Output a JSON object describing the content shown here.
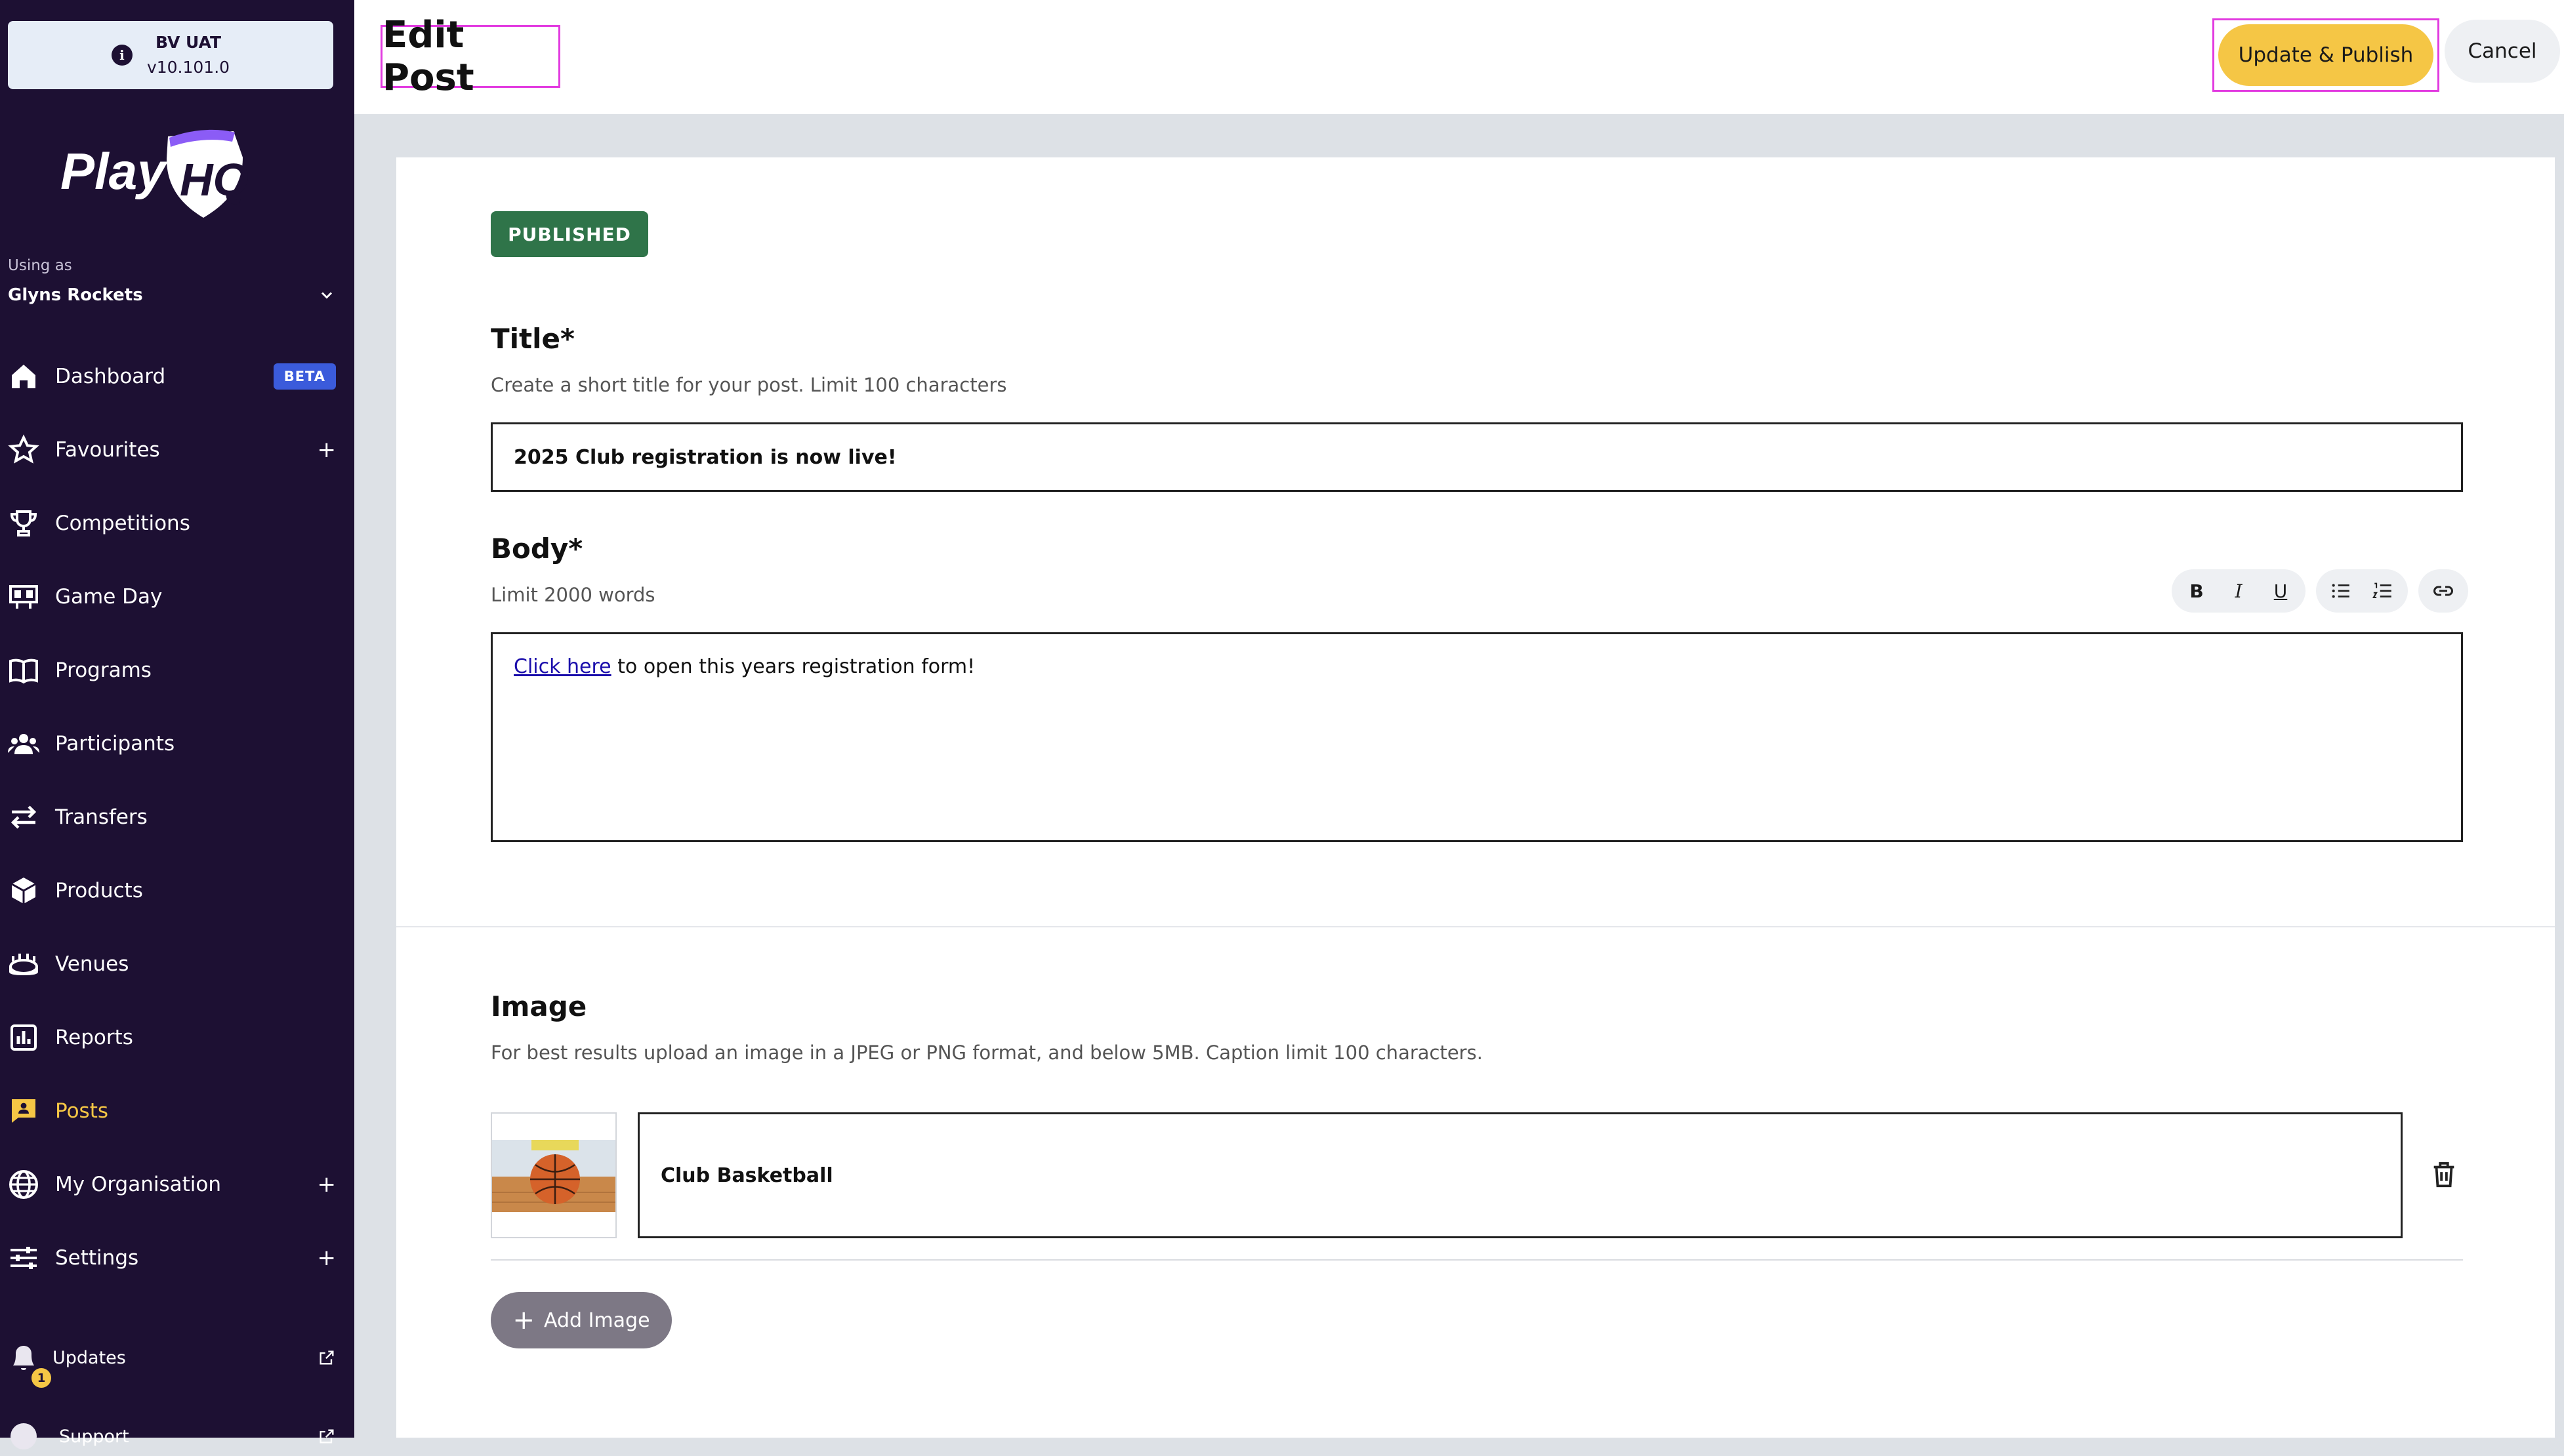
{
  "environment": {
    "name": "BV UAT",
    "version": "v10.101.0",
    "info_icon": "info-icon"
  },
  "brand": {
    "logo_text": "PlayHQ",
    "colors": {
      "sidebar_bg": "#1d1033",
      "accent": "#f5c645",
      "status_published": "#2f7449",
      "beta": "#3b5bdb"
    }
  },
  "account": {
    "using_as_label": "Using as",
    "org_name": "Glyns Rockets"
  },
  "sidebar": {
    "items": [
      {
        "label": "Dashboard",
        "icon": "home-icon",
        "badge": "BETA"
      },
      {
        "label": "Favourites",
        "icon": "star-icon",
        "expand": "+"
      },
      {
        "label": "Competitions",
        "icon": "trophy-icon"
      },
      {
        "label": "Game Day",
        "icon": "scoreboard-icon"
      },
      {
        "label": "Programs",
        "icon": "book-icon"
      },
      {
        "label": "Participants",
        "icon": "people-icon"
      },
      {
        "label": "Transfers",
        "icon": "transfer-icon"
      },
      {
        "label": "Products",
        "icon": "box-icon"
      },
      {
        "label": "Venues",
        "icon": "stadium-icon"
      },
      {
        "label": "Reports",
        "icon": "report-icon"
      },
      {
        "label": "Posts",
        "icon": "posts-icon",
        "active": true
      },
      {
        "label": "My Organisation",
        "icon": "globe-icon",
        "expand": "+"
      },
      {
        "label": "Settings",
        "icon": "sliders-icon",
        "expand": "+"
      }
    ],
    "updates": {
      "label": "Updates",
      "badge_count": "1"
    },
    "support": {
      "label": "Support"
    }
  },
  "header": {
    "title": "Edit Post",
    "primary_action": "Update & Publish",
    "secondary_action": "Cancel"
  },
  "post": {
    "status": "PUBLISHED",
    "title_label": "Title*",
    "title_help": "Create a short title for your post. Limit 100 characters",
    "title_value": "2025 Club registration is now live!",
    "body_label": "Body*",
    "body_help": "Limit 2000 words",
    "body_link_text": "Click here",
    "body_text": " to open this years registration form!",
    "toolbar": {
      "bold": "B",
      "italic": "I",
      "underline": "U",
      "bullet_list": "bullet-list-icon",
      "numbered_list": "numbered-list-icon",
      "link": "link-icon"
    },
    "image_label": "Image",
    "image_help": "For best results upload an image in a JPEG or PNG format, and below 5MB. Caption limit 100 characters.",
    "image_caption": "Club Basketball",
    "add_image_label": "Add Image"
  }
}
